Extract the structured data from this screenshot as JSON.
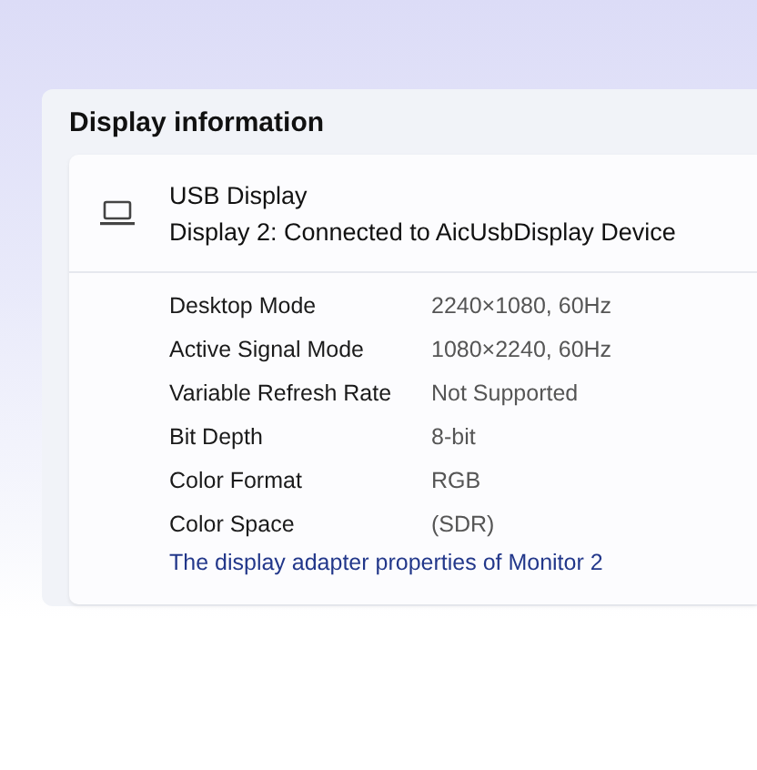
{
  "section_title": "Display information",
  "device": {
    "name": "USB Display",
    "description": "Display 2: Connected to AicUsbDisplay Device"
  },
  "properties": [
    {
      "label": "Desktop Mode",
      "value": "2240×1080, 60Hz"
    },
    {
      "label": "Active Signal Mode",
      "value": "1080×2240, 60Hz"
    },
    {
      "label": "Variable Refresh Rate",
      "value": "Not Supported"
    },
    {
      "label": "Bit Depth",
      "value": "8-bit"
    },
    {
      "label": "Color Format",
      "value": "RGB"
    },
    {
      "label": "Color Space",
      "value": "(SDR)"
    }
  ],
  "link": "The display adapter properties of Monitor 2"
}
